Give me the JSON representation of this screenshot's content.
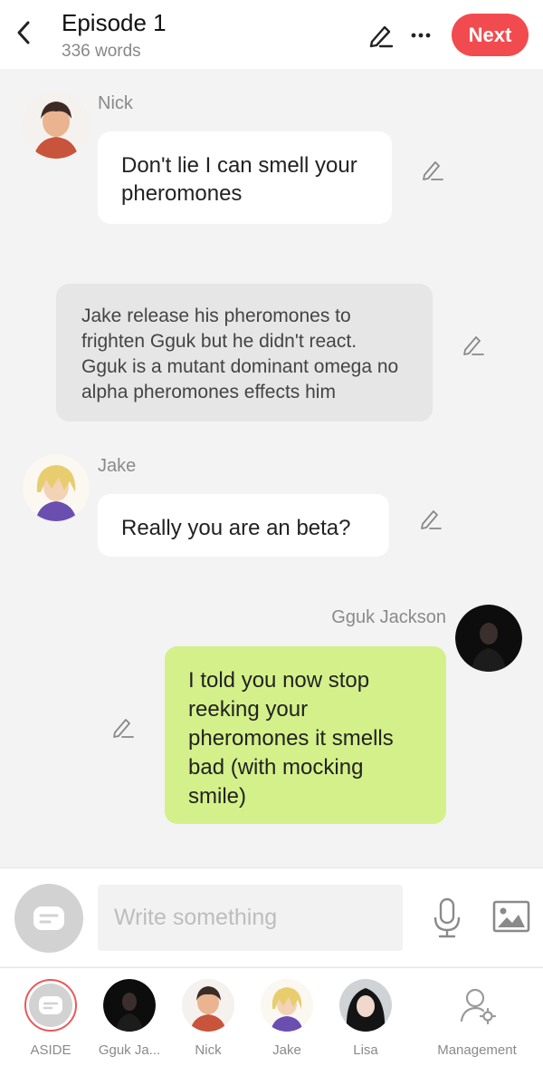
{
  "header": {
    "title": "Episode 1",
    "word_count": "336 words",
    "next_label": "Next"
  },
  "messages": [
    {
      "type": "character",
      "speaker": "Nick",
      "text": "Don't lie I can smell your pheromones"
    },
    {
      "type": "narration",
      "text": "Jake release his pheromones to frighten Gguk but he didn't react. Gguk is a mutant dominant omega no alpha pheromones effects him"
    },
    {
      "type": "character",
      "speaker": "Jake",
      "text": "Really you are an beta?"
    },
    {
      "type": "self",
      "speaker": "Gguk Jackson",
      "text": "I told you now stop reeking your pheromones it smells bad (with mocking smile)"
    }
  ],
  "composer": {
    "placeholder": "Write something"
  },
  "bottom_nav": {
    "items": [
      {
        "label": "ASIDE"
      },
      {
        "label": "Gguk Ja..."
      },
      {
        "label": "Nick"
      },
      {
        "label": "Jake"
      },
      {
        "label": "Lisa"
      },
      {
        "label": "Management"
      }
    ]
  },
  "colors": {
    "accent": "#f24b4f",
    "self_bubble": "#d4f08a",
    "narration_bubble": "#e6e6e6",
    "background": "#f3f3f3"
  }
}
